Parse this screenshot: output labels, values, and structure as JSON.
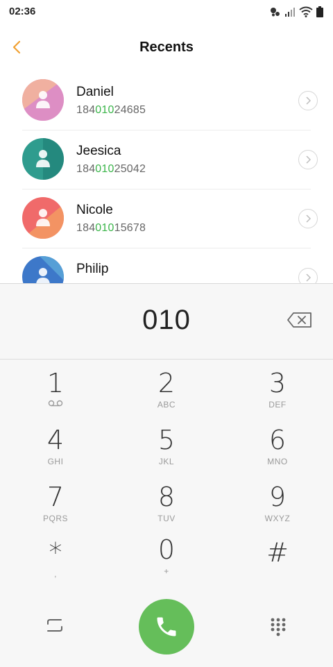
{
  "status_bar": {
    "time": "02:36"
  },
  "header": {
    "title": "Recents"
  },
  "contacts": [
    {
      "name": "Daniel",
      "num_prefix": "184",
      "num_match": "010",
      "num_suffix": "24685"
    },
    {
      "name": "Jeesica",
      "num_prefix": "184",
      "num_match": "010",
      "num_suffix": "25042"
    },
    {
      "name": "Nicole",
      "num_prefix": "184",
      "num_match": "010",
      "num_suffix": "15678"
    },
    {
      "name": "Philip",
      "num_prefix": "",
      "num_match": "",
      "num_suffix": ""
    }
  ],
  "dialer": {
    "input": "010",
    "keys": [
      {
        "digit": "1",
        "letters": ""
      },
      {
        "digit": "2",
        "letters": "ABC"
      },
      {
        "digit": "3",
        "letters": "DEF"
      },
      {
        "digit": "4",
        "letters": "GHI"
      },
      {
        "digit": "5",
        "letters": "JKL"
      },
      {
        "digit": "6",
        "letters": "MNO"
      },
      {
        "digit": "7",
        "letters": "PQRS"
      },
      {
        "digit": "8",
        "letters": "TUV"
      },
      {
        "digit": "9",
        "letters": "WXYZ"
      },
      {
        "digit": "*",
        "letters": ","
      },
      {
        "digit": "0",
        "letters": "+"
      },
      {
        "digit": "#",
        "letters": ""
      }
    ]
  },
  "colors": {
    "accent_back": "#f0a030",
    "match_green": "#3bb54a",
    "call_button": "#65be5a"
  }
}
